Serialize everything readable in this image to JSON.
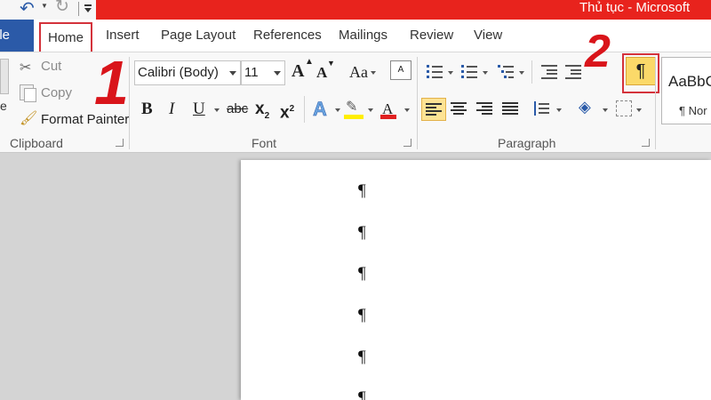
{
  "title_bar": {
    "title": "Thủ tục - Microsoft"
  },
  "tabs": {
    "file": "ile",
    "home": "Home",
    "insert": "Insert",
    "page_layout": "Page Layout",
    "references": "References",
    "mailings": "Mailings",
    "review": "Review",
    "view": "View"
  },
  "clipboard": {
    "paste_partial": "e",
    "cut": "Cut",
    "copy": "Copy",
    "format_painter": "Format Painter",
    "label": "Clipboard"
  },
  "font": {
    "font_name": "Calibri (Body)",
    "font_size": "11",
    "grow": "A",
    "shrink": "A",
    "change_case": "Aa",
    "bold": "B",
    "italic": "I",
    "underline": "U",
    "strikethrough": "abc",
    "subscript": "x",
    "subscript_mark": "2",
    "superscript": "x",
    "superscript_mark": "2",
    "text_effects": "A",
    "font_color": "A",
    "label": "Font"
  },
  "paragraph": {
    "show_hide_symbol": "¶",
    "label": "Paragraph"
  },
  "styles": {
    "sample": "AaBbC",
    "name": "¶ Nor"
  },
  "annotations": {
    "step_1": "1",
    "step_2": "2"
  },
  "document": {
    "paragraph_marks": [
      "¶",
      "¶",
      "¶",
      "¶",
      "¶",
      "¶"
    ]
  },
  "colors": {
    "title_bar": "#e8231d",
    "file_tab": "#2b5aa8",
    "highlight_frame": "#d4323b",
    "active_button": "#fbd969",
    "annotation": "#d9141a",
    "font_color_bar": "#e02020",
    "highlight_bar": "#ffee00"
  }
}
